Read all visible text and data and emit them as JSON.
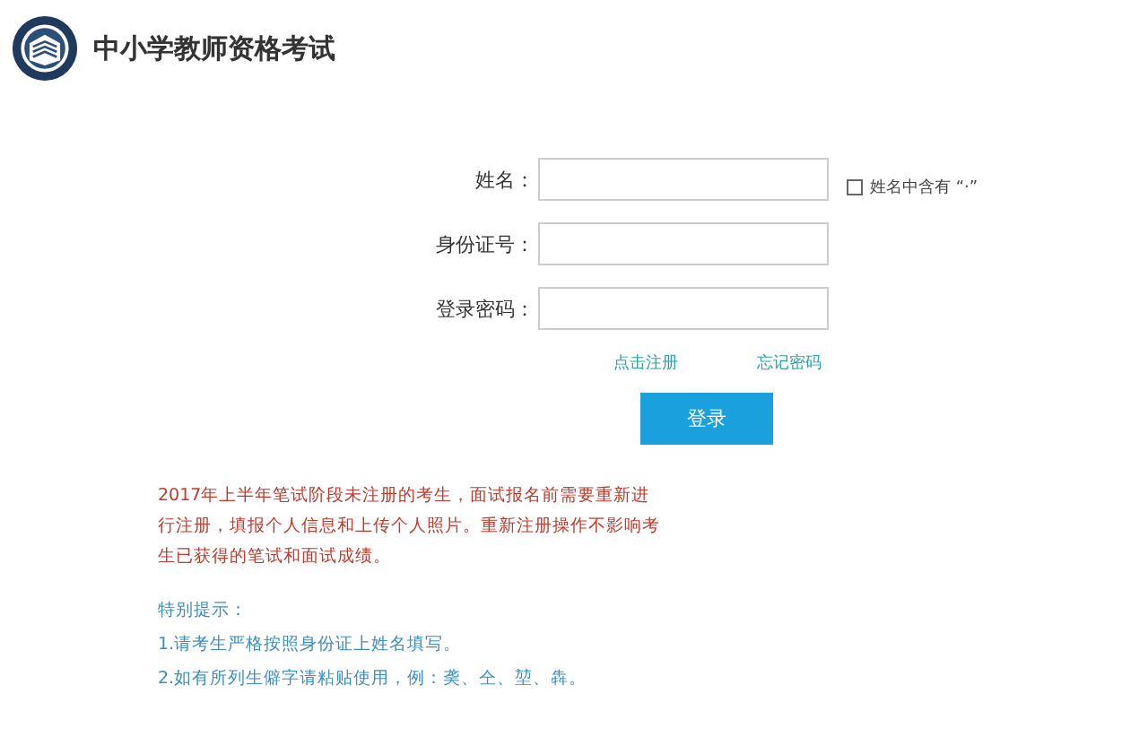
{
  "header": {
    "title": "中小学教师资格考试"
  },
  "form": {
    "fields": [
      {
        "label": "姓名："
      },
      {
        "label": "身份证号："
      },
      {
        "label": "登录密码："
      }
    ],
    "name_option": {
      "label": "姓名中含有",
      "mark": "“·”",
      "checked": false
    },
    "links": [
      "点击注册",
      "忘记密码"
    ],
    "submit": "登录"
  },
  "notice": "2017年上半年笔试阶段未注册的考生，面试报名前需要重新进行注册，填报个人信息和上传个人照片。重新注册操作不影响考生已获得的笔试和面试成绩。",
  "tips": {
    "title": "特别提示：",
    "items": [
      "1.请考生严格按照身份证上姓名填写。",
      "2.如有所列生僻字请粘贴使用，例：䶮、仝、堃、犇。"
    ]
  }
}
